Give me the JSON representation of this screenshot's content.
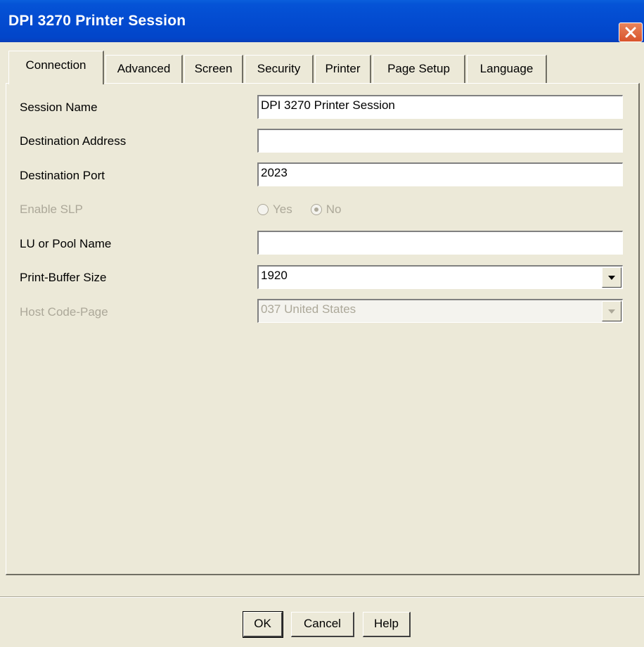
{
  "window": {
    "title": "DPI 3270 Printer Session"
  },
  "tabs": [
    {
      "label": "Connection",
      "active": true
    },
    {
      "label": "Advanced",
      "active": false
    },
    {
      "label": "Screen",
      "active": false
    },
    {
      "label": "Security",
      "active": false
    },
    {
      "label": "Printer",
      "active": false
    },
    {
      "label": "Page Setup",
      "active": false
    },
    {
      "label": "Language",
      "active": false
    }
  ],
  "form": {
    "session_name": {
      "label": "Session Name",
      "value": "DPI 3270 Printer Session"
    },
    "destination_address": {
      "label": "Destination Address",
      "value": ""
    },
    "destination_port": {
      "label": "Destination Port",
      "value": "2023"
    },
    "enable_slp": {
      "label": "Enable SLP",
      "yes_label": "Yes",
      "no_label": "No",
      "selected": "No",
      "enabled": false
    },
    "lu_pool_name": {
      "label": "LU or Pool Name",
      "value": ""
    },
    "print_buffer_size": {
      "label": "Print-Buffer Size",
      "value": "1920"
    },
    "host_code_page": {
      "label": "Host Code-Page",
      "value": "037 United States",
      "enabled": false
    }
  },
  "buttons": {
    "ok": "OK",
    "cancel": "Cancel",
    "help": "Help"
  },
  "colors": {
    "title_bar": "#0553d6",
    "close_button": "#d9542b",
    "face": "#ece9d8",
    "disabled_text": "#aca899"
  },
  "icons": {
    "close": "close-icon",
    "dropdown": "chevron-down-icon"
  }
}
